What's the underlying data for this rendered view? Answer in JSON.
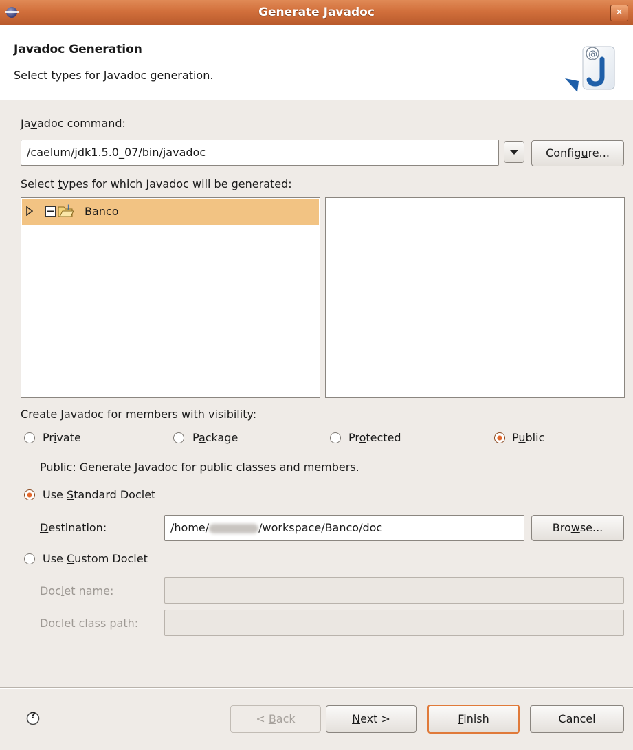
{
  "window": {
    "title": "Generate Javadoc",
    "close_glyph": "✕"
  },
  "header": {
    "title": "Javadoc Generation",
    "description": "Select types for Javadoc generation."
  },
  "javadoc_command": {
    "label_pre": "Ja",
    "label_mnemonic": "v",
    "label_post": "adoc command:",
    "value": "/caelum/jdk1.5.0_07/bin/javadoc",
    "configure_pre": "Config",
    "configure_mnemonic": "u",
    "configure_post": "re..."
  },
  "types": {
    "label_pre": "Select ",
    "label_mnemonic": "t",
    "label_post": "ypes for which Javadoc will be generated:",
    "tree": [
      {
        "label": "Banco",
        "icon": "project-folder-icon",
        "selected": true
      }
    ]
  },
  "visibility": {
    "label": "Create Javadoc for members with visibility:",
    "options": [
      {
        "pre": "Pr",
        "mn": "i",
        "post": "vate",
        "checked": false
      },
      {
        "pre": "P",
        "mn": "a",
        "post": "ckage",
        "checked": false
      },
      {
        "pre": "Pr",
        "mn": "o",
        "post": "tected",
        "checked": false
      },
      {
        "pre": "P",
        "mn": "u",
        "post": "blic",
        "checked": true
      }
    ],
    "description": "Public: Generate Javadoc for public classes and members."
  },
  "standard_doclet": {
    "pre": "Use ",
    "mn": "S",
    "post": "tandard Doclet",
    "checked": true,
    "destination_mn": "D",
    "destination_post": "estination:",
    "destination_pre_value": "/home/",
    "destination_post_value": "/workspace/Banco/doc",
    "browse_pre": "Bro",
    "browse_mn": "w",
    "browse_post": "se..."
  },
  "custom_doclet": {
    "pre": "Use ",
    "mn": "C",
    "post": "ustom Doclet",
    "checked": false,
    "name_pre": "Doc",
    "name_mn": "l",
    "name_post": "et name:",
    "classpath_label": "Doclet class path:"
  },
  "footer": {
    "help_glyph": "?",
    "back_pre": "< ",
    "back_mn": "B",
    "back_post": "ack",
    "next_mn": "N",
    "next_post": "ext >",
    "finish_mn": "F",
    "finish_post": "inish",
    "cancel_label": "Cancel"
  },
  "colors": {
    "accent": "#e07a3a",
    "selection": "#f2c383",
    "titlebar": "#d2703c"
  }
}
